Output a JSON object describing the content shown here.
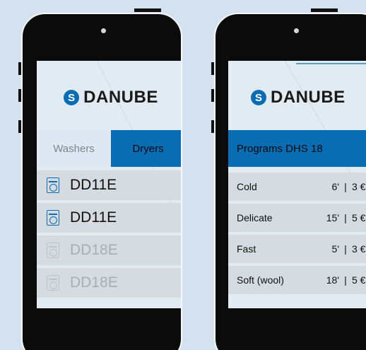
{
  "phone1": {
    "brand": "DANUBE",
    "tabs": [
      {
        "label": "Washers",
        "active": false
      },
      {
        "label": "Dryers",
        "active": true
      }
    ],
    "machines": [
      {
        "label": "DD11E",
        "available": true
      },
      {
        "label": "DD11E",
        "available": true
      },
      {
        "label": "DD18E",
        "available": false
      },
      {
        "label": "DD18E",
        "available": false
      }
    ]
  },
  "phone2": {
    "brand": "DANUBE",
    "header": "Programs DHS 18",
    "programs": [
      {
        "name": "Cold",
        "time": "6'",
        "sep": "|",
        "price": "3 €"
      },
      {
        "name": "Delicate",
        "time": "15'",
        "sep": "|",
        "price": "5 €"
      },
      {
        "name": "Fast",
        "time": "5'",
        "sep": "|",
        "price": "3 €"
      },
      {
        "name": "Soft (wool)",
        "time": "18'",
        "sep": "|",
        "price": "5 €"
      }
    ]
  },
  "colors": {
    "accent": "#0a6cb2",
    "background": "#d4e2ef",
    "screen": "#e3ebf2",
    "row": "#d5dbe0"
  },
  "icons": {
    "brand": "danube-logo-icon",
    "machine": "washer-icon"
  }
}
